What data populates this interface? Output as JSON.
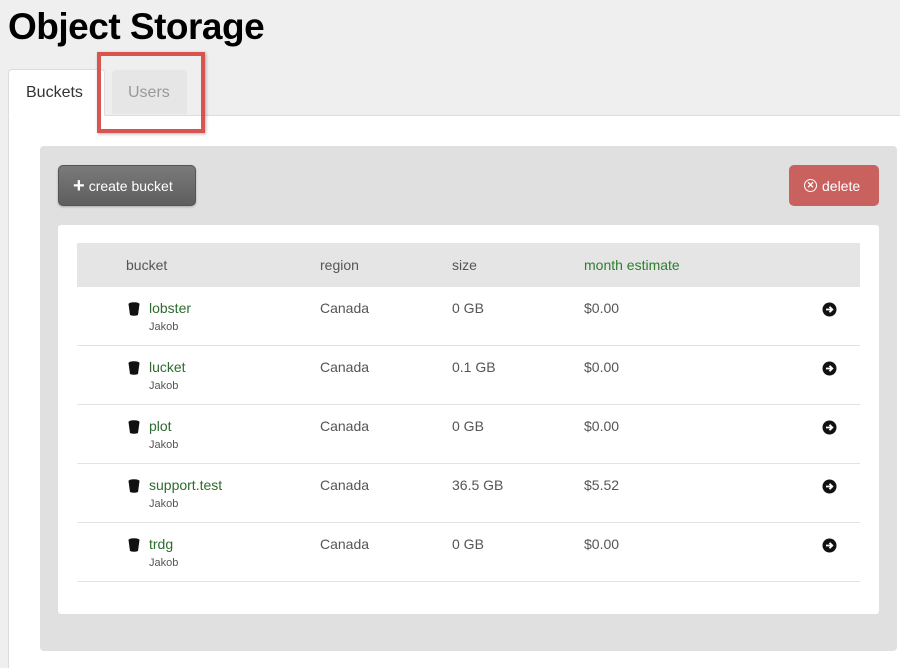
{
  "page": {
    "title": "Object Storage"
  },
  "tabs": [
    {
      "label": "Buckets",
      "active": true
    },
    {
      "label": "Users",
      "active": false
    }
  ],
  "toolbar": {
    "create_label": "create bucket",
    "delete_label": "delete"
  },
  "table": {
    "headers": {
      "bucket": "bucket",
      "region": "region",
      "size": "size",
      "estimate": "month estimate"
    },
    "rows": [
      {
        "name": "lobster",
        "owner": "Jakob",
        "region": "Canada",
        "size": "0 GB",
        "estimate": "$0.00"
      },
      {
        "name": "lucket",
        "owner": "Jakob",
        "region": "Canada",
        "size": "0.1 GB",
        "estimate": "$0.00"
      },
      {
        "name": "plot",
        "owner": "Jakob",
        "region": "Canada",
        "size": "0 GB",
        "estimate": "$0.00"
      },
      {
        "name": "support.test",
        "owner": "Jakob",
        "region": "Canada",
        "size": "36.5 GB",
        "estimate": "$5.52"
      },
      {
        "name": "trdg",
        "owner": "Jakob",
        "region": "Canada",
        "size": "0 GB",
        "estimate": "$0.00"
      }
    ]
  },
  "icons": {
    "create": "plus-icon",
    "delete": "close-circle-icon",
    "bucket": "bucket-icon",
    "row_action": "arrow-right-circle-icon"
  },
  "colors": {
    "delete_button": "#c9625f",
    "create_button": "#6b6b6b",
    "link_green": "#2e6b2e",
    "highlight": "#d9534f"
  }
}
